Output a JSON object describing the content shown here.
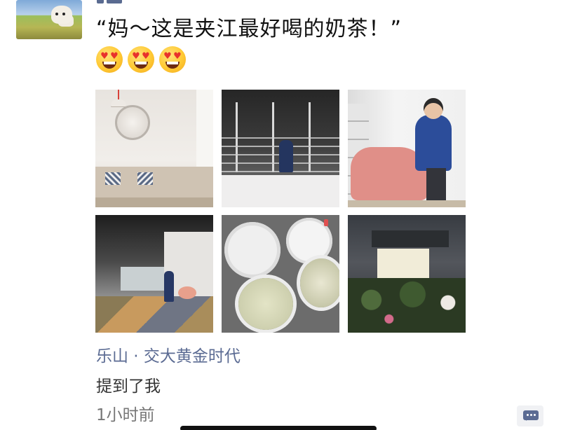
{
  "post": {
    "text": "“妈～这是夹江最好喝的奶茶！”",
    "emojis": [
      "heart-eyes-emoji",
      "heart-eyes-emoji",
      "heart-eyes-emoji"
    ],
    "photo_count": 6,
    "location": "乐山 · 交大黄金时代",
    "mention": "提到了我",
    "timestamp": "1小时前"
  },
  "colors": {
    "link": "#5b6b93",
    "text": "#111111",
    "muted": "#777777"
  },
  "icons": {
    "comment": "comment-bubble-icon"
  }
}
